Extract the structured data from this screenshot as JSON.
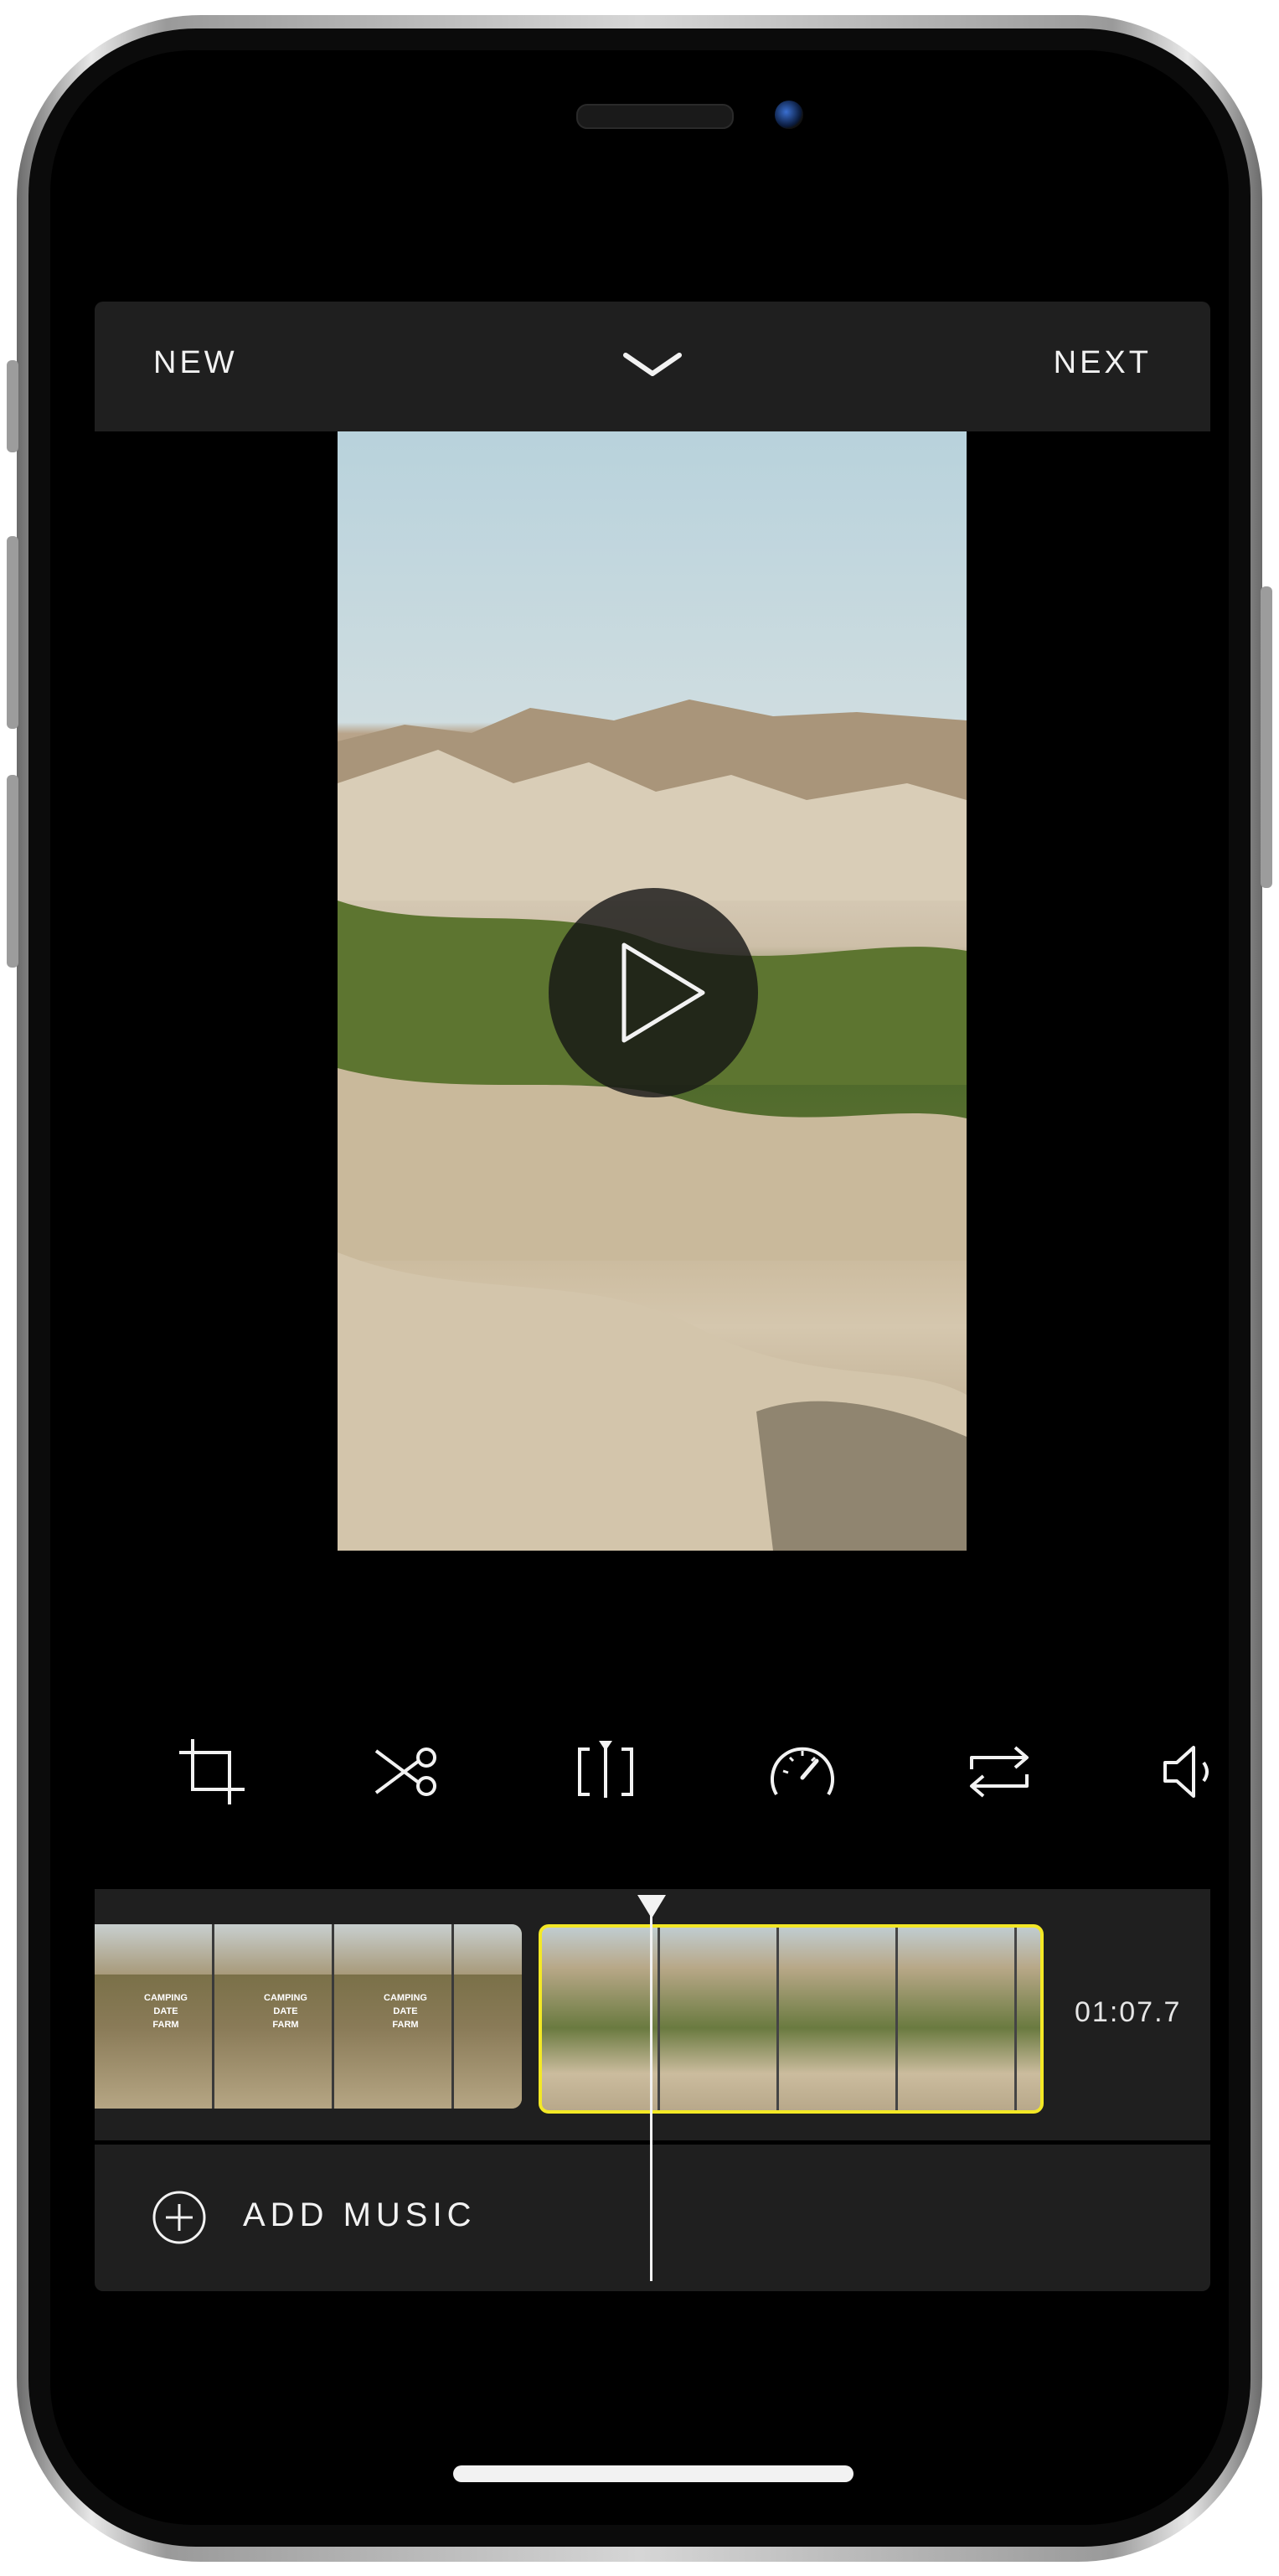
{
  "header": {
    "new_label": "NEW",
    "next_label": "NEXT"
  },
  "preview": {
    "state": "paused"
  },
  "tools": [
    {
      "icon": "crop-icon"
    },
    {
      "icon": "scissors-icon"
    },
    {
      "icon": "split-icon"
    },
    {
      "icon": "speed-gauge-icon"
    },
    {
      "icon": "loop-icon"
    },
    {
      "icon": "volume-icon"
    }
  ],
  "timeline": {
    "clip1_overlay_text": [
      "CAMPING",
      "DATE",
      "FARM"
    ],
    "duration": "01:07.7",
    "selected_clip_border_color": "#f3e826"
  },
  "music": {
    "label": "ADD MUSIC"
  },
  "colors": {
    "background": "#000000",
    "panel": "#1f1f1f",
    "accent": "#f3e826"
  }
}
